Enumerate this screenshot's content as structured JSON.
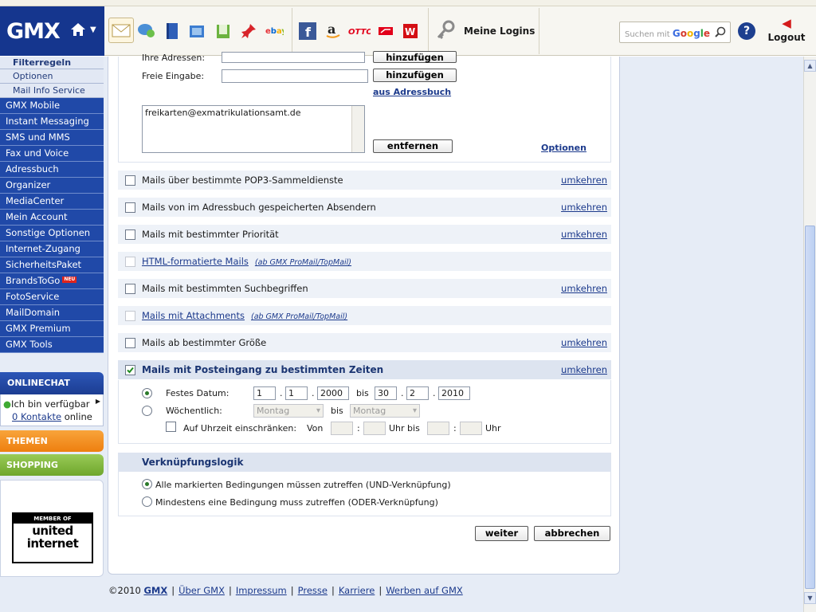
{
  "header": {
    "logo": "GMX",
    "meine_logins": "Meine Logins",
    "search_placeholder": "Suchen mit",
    "search_brand": "Google",
    "help": "?",
    "logout": "Logout"
  },
  "sidebar": {
    "sub_items": [
      "Filterregeln",
      "Optionen",
      "Mail Info Service"
    ],
    "items": [
      "GMX Mobile",
      "Instant Messaging",
      "SMS und MMS",
      "Fax und Voice",
      "Adressbuch",
      "Organizer",
      "MediaCenter",
      "Mein Account",
      "Sonstige Optionen",
      "Internet-Zugang",
      "SicherheitsPaket",
      "BrandsToGo",
      "FotoService",
      "MailDomain",
      "GMX Premium",
      "GMX Tools"
    ],
    "neu_badge": "NEU",
    "onlinechat": "ONLINECHAT",
    "chat_status": "Ich bin verfügbar",
    "chat_contacts_link": "0 Kontakte",
    "chat_contacts_suffix": "online",
    "themen": "THEMEN",
    "shopping": "SHOPPING",
    "ui_top": "MEMBER OF",
    "ui_brand_1": "united",
    "ui_brand_2": "internet"
  },
  "filter": {
    "label_addresses": "Ihre Adressen:",
    "btn_hinzufuegen_top": "hinzufügen",
    "label_free": "Freie Eingabe:",
    "free_value": "",
    "btn_hinzufuegen": "hinzufügen",
    "link_adressbuch": "aus Adressbuch",
    "list_value": "freikarten@exmatrikulationsamt.de",
    "btn_entfernen": "entfernen",
    "link_optionen": "Optionen"
  },
  "conditions": [
    {
      "label": "Mails über bestimmte POP3-Sammeldienste",
      "reverse": "umkehren"
    },
    {
      "label": "Mails von im Adressbuch gespeicherten Absendern",
      "reverse": "umkehren"
    },
    {
      "label": "Mails mit bestimmter Priorität",
      "reverse": "umkehren"
    },
    {
      "label": "HTML-formatierte Mails",
      "note": "(ab GMX ProMail/TopMail)"
    },
    {
      "label": "Mails mit bestimmten Suchbegriffen",
      "reverse": "umkehren"
    },
    {
      "label": "Mails mit Attachments",
      "note": "(ab GMX ProMail/TopMail)"
    },
    {
      "label": "Mails ab bestimmter Größe",
      "reverse": "umkehren"
    },
    {
      "label": "Mails mit Posteingang zu bestimmten Zeiten",
      "reverse": "umkehren",
      "checked": true
    }
  ],
  "zeit": {
    "festes_datum": "Festes Datum:",
    "from_day": "1",
    "from_month": "1",
    "from_year": "2000",
    "bis": "bis",
    "to_day": "30",
    "to_month": "2",
    "to_year": "2010",
    "dot": ".",
    "woechentlich": "Wöchentlich:",
    "weekday_from": "Montag",
    "weekday_to": "Montag",
    "uhrzeit": "Auf Uhrzeit einschränken:",
    "von": "Von",
    "colon": ":",
    "uhr_bis": "Uhr bis",
    "uhr": "Uhr"
  },
  "logik": {
    "title": "Verknüpfungslogik",
    "option_and": "Alle markierten Bedingungen müssen zutreffen (UND-Verknüpfung)",
    "option_or": "Mindestens eine Bedingung muss zutreffen (ODER-Verknüpfung)"
  },
  "actions": {
    "weiter": "weiter",
    "abbrechen": "abbrechen"
  },
  "footer": {
    "copyright": "©2010",
    "gmx": "GMX",
    "links": [
      "Über GMX",
      "Impressum",
      "Presse",
      "Karriere",
      "Werben auf GMX"
    ]
  },
  "colors": {
    "brand_blue": "#15368e",
    "sidebar_blue": "#2049a8",
    "link_blue": "#1c3a8c",
    "themen_orange": "#ee7f0f",
    "shopping_green": "#6ea62c"
  }
}
